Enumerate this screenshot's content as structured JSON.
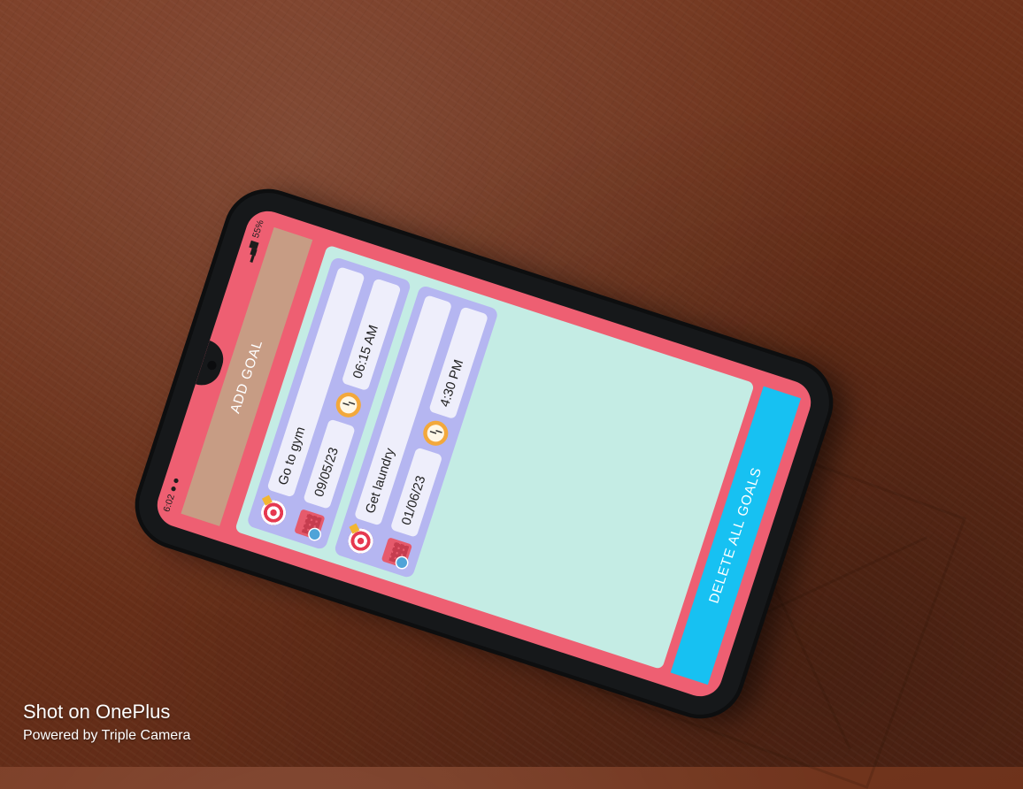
{
  "status_bar": {
    "time": "6:02",
    "battery": "55%"
  },
  "app": {
    "add_goal_label": "ADD GOAL",
    "delete_all_label": "DELETE ALL GOALS",
    "goals": [
      {
        "title": "Go to gym",
        "date": "09/05/23",
        "time": "06:15 AM"
      },
      {
        "title": "Get laundry",
        "date": "01/06/23",
        "time": "4:30 PM"
      }
    ]
  },
  "photo_watermark": {
    "line1": "Shot on OnePlus",
    "line2": "Powered by Triple Camera"
  },
  "colors": {
    "screen_bg": "#ee5f72",
    "add_goal_bg": "#c79c84",
    "list_bg": "#c4ece4",
    "card_bg": "#b5b6f1",
    "delete_bg": "#17c1f2"
  }
}
